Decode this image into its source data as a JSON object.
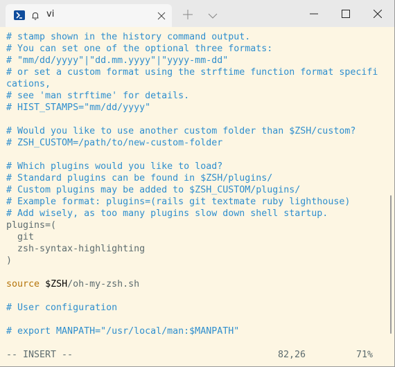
{
  "window": {
    "tab_title": "vi",
    "icons": [
      "powershell-icon",
      "bell-icon",
      "close-icon",
      "plus-icon",
      "chevron-down-icon",
      "minimize-icon",
      "maximize-icon",
      "close-icon"
    ]
  },
  "colors": {
    "background": "#fdf6e3",
    "comment": "#2e8ece",
    "text": "#5c6b6e",
    "keyword": "#b5740a",
    "variable": "#d33682"
  },
  "editor": {
    "lines": [
      [
        {
          "t": "# stamp shown in the history command output.",
          "c": "comment"
        }
      ],
      [
        {
          "t": "# You can set one of the optional three formats:",
          "c": "comment"
        }
      ],
      [
        {
          "t": "# \"mm/dd/yyyy\"|\"dd.mm.yyyy\"|\"yyyy-mm-dd\"",
          "c": "comment"
        }
      ],
      [
        {
          "t": "# or set a custom format using the strftime function format specifi",
          "c": "comment"
        }
      ],
      [
        {
          "t": "cations,",
          "c": "comment"
        }
      ],
      [
        {
          "t": "# see 'man strftime' for details.",
          "c": "comment"
        }
      ],
      [
        {
          "t": "# HIST_STAMPS=\"mm/dd/yyyy\"",
          "c": "comment"
        }
      ],
      [
        {
          "t": "",
          "c": "text"
        }
      ],
      [
        {
          "t": "# Would you like to use another custom folder than $ZSH/custom?",
          "c": "comment"
        }
      ],
      [
        {
          "t": "# ZSH_CUSTOM=/path/to/new-custom-folder",
          "c": "comment"
        }
      ],
      [
        {
          "t": "",
          "c": "text"
        }
      ],
      [
        {
          "t": "# Which plugins would you like to load?",
          "c": "comment"
        }
      ],
      [
        {
          "t": "# Standard plugins can be found in $ZSH/plugins/",
          "c": "comment"
        }
      ],
      [
        {
          "t": "# Custom plugins may be added to $ZSH_CUSTOM/plugins/",
          "c": "comment"
        }
      ],
      [
        {
          "t": "# Example format: plugins=(rails git textmate ruby lighthouse)",
          "c": "comment"
        }
      ],
      [
        {
          "t": "# Add wisely, as too many plugins slow down shell startup.",
          "c": "comment"
        }
      ],
      [
        {
          "t": "plugins=(",
          "c": "text"
        }
      ],
      [
        {
          "t": "  git",
          "c": "text"
        }
      ],
      [
        {
          "t": "  zsh-syntax-highlighting",
          "c": "text"
        }
      ],
      [
        {
          "t": ")",
          "c": "text"
        }
      ],
      [
        {
          "t": "",
          "c": "text"
        }
      ],
      [
        {
          "t": "source",
          "c": "keyword"
        },
        {
          "t": " ",
          "c": "text"
        },
        {
          "t": "$ZSH",
          "c": "variable"
        },
        {
          "t": "/oh-my-zsh.sh",
          "c": "text"
        }
      ],
      [
        {
          "t": "",
          "c": "text"
        }
      ],
      [
        {
          "t": "# User configuration",
          "c": "comment"
        }
      ],
      [
        {
          "t": "",
          "c": "text"
        }
      ],
      [
        {
          "t": "# export MANPATH=\"/usr/local/man:$MANPATH\"",
          "c": "comment"
        }
      ]
    ]
  },
  "status_bar": {
    "mode": "-- INSERT --",
    "position": "82,26",
    "percent": "71%"
  }
}
